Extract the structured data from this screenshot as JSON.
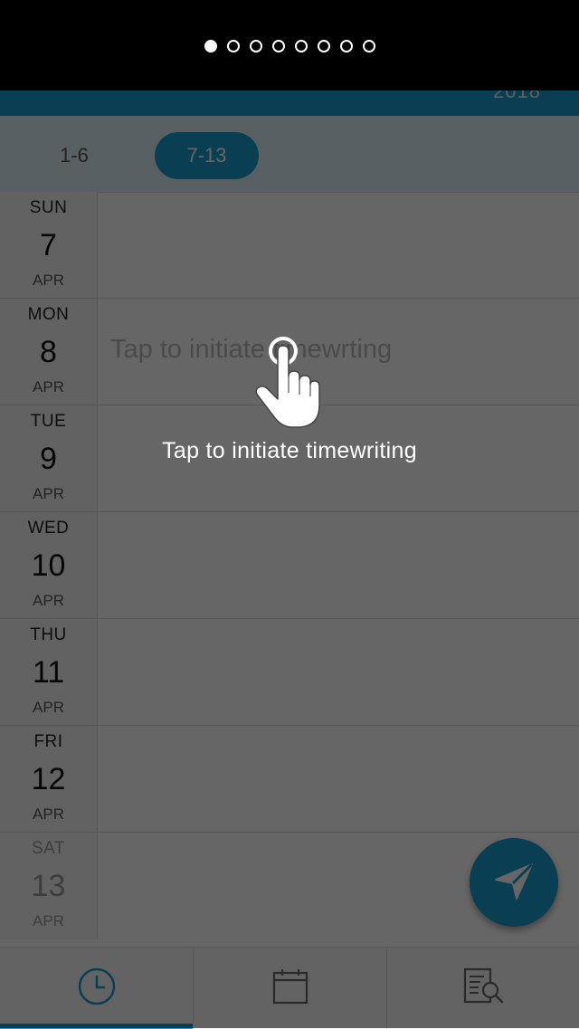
{
  "header": {
    "year": "2018"
  },
  "weeks": [
    {
      "label": "1-6",
      "selected": false
    },
    {
      "label": "7-13",
      "selected": true
    }
  ],
  "days": [
    {
      "dow": "SUN",
      "num": "7",
      "month": "APR",
      "entry": ""
    },
    {
      "dow": "MON",
      "num": "8",
      "month": "APR",
      "entry": "Tap to initiate timewrting"
    },
    {
      "dow": "TUE",
      "num": "9",
      "month": "APR",
      "entry": ""
    },
    {
      "dow": "WED",
      "num": "10",
      "month": "APR",
      "entry": ""
    },
    {
      "dow": "THU",
      "num": "11",
      "month": "APR",
      "entry": ""
    },
    {
      "dow": "FRI",
      "num": "12",
      "month": "APR",
      "entry": ""
    },
    {
      "dow": "SAT",
      "num": "13",
      "month": "APR",
      "entry": ""
    }
  ],
  "bottom_nav": [
    {
      "icon": "clock-icon",
      "active": true
    },
    {
      "icon": "calendar-icon",
      "active": false
    },
    {
      "icon": "report-search-icon",
      "active": false
    }
  ],
  "fab": {
    "icon": "send-icon"
  },
  "tutorial": {
    "page_count": 8,
    "current_page": 1,
    "hint": "Tap to initiate timewriting",
    "gesture_icon": "tap-hand-icon"
  },
  "colors": {
    "accent": "#1a9bd0",
    "week_bar": "#dff0f8",
    "overlay": "rgba(0,0,0,0.6)"
  }
}
